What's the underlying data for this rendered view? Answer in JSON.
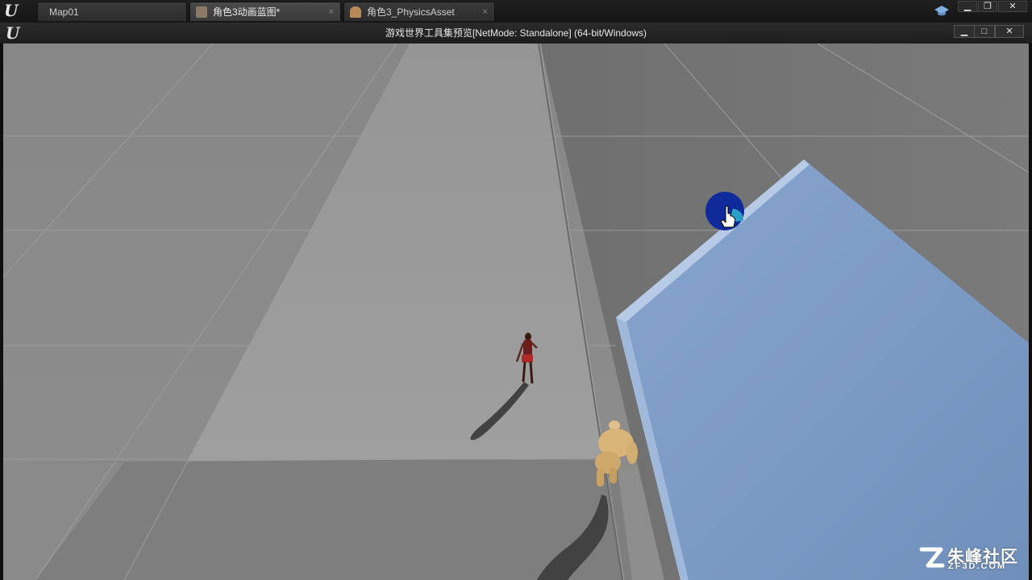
{
  "editor": {
    "tabs": [
      {
        "label": "Map01",
        "active": false,
        "icon": "level-icon"
      },
      {
        "label": "角色3动画蓝图*",
        "active": true,
        "icon": "anim-blueprint-icon"
      },
      {
        "label": "角色3_PhysicsAsset",
        "active": false,
        "icon": "physics-asset-icon"
      }
    ],
    "tab_close_glyph": "×",
    "window_buttons": {
      "minimize": "▁",
      "restore": "❐",
      "close": "✕"
    }
  },
  "preview_window": {
    "title": "游戏世界工具集预览[NetMode: Standalone] (64-bit/Windows)",
    "buttons": {
      "minimize": "▁",
      "maximize": "□",
      "close": "✕"
    }
  },
  "viewport": {
    "colors": {
      "floor_light": "#8f8f8f",
      "floor_dark": "#707070",
      "road": "#9a9a9a",
      "platform": "#7d9cc6",
      "cursor_highlight": "#0f2a9a",
      "player_mannequin": "#d9b57a",
      "npc_character": "#8a2020"
    }
  },
  "watermark": {
    "name": "朱峰社区",
    "domain": "ZF3D.COM"
  }
}
